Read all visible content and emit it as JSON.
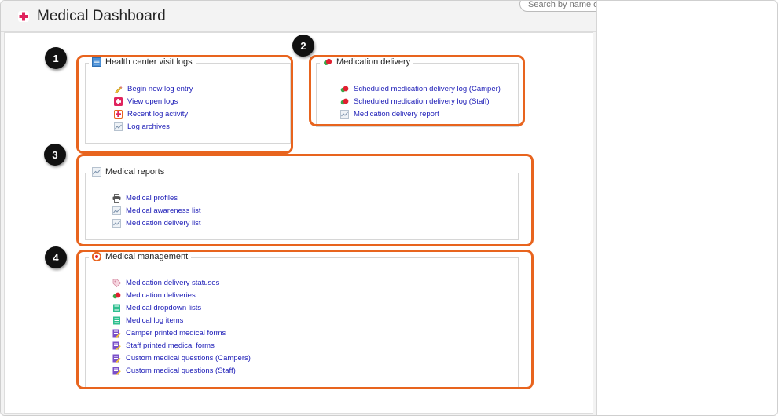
{
  "header": {
    "title": "Medical Dashboard",
    "search_placeholder": "Search by name or e"
  },
  "sections": {
    "visit_logs": {
      "title": "Health center visit logs",
      "items": [
        {
          "label": "Begin new log entry",
          "icon": "pencil-icon"
        },
        {
          "label": "View open logs",
          "icon": "medical-cross-icon"
        },
        {
          "label": "Recent log activity",
          "icon": "medical-cross-outline-icon"
        },
        {
          "label": "Log archives",
          "icon": "chart-icon"
        }
      ]
    },
    "med_delivery": {
      "title": "Medication delivery",
      "items": [
        {
          "label": "Scheduled medication delivery log (Camper)",
          "icon": "pills-icon"
        },
        {
          "label": "Scheduled medication delivery log (Staff)",
          "icon": "pills-icon"
        },
        {
          "label": "Medication delivery report",
          "icon": "chart-icon"
        }
      ]
    },
    "reports": {
      "title": "Medical reports",
      "items": [
        {
          "label": "Medical profiles",
          "icon": "printer-icon"
        },
        {
          "label": "Medical awareness list",
          "icon": "chart-icon"
        },
        {
          "label": "Medication delivery list",
          "icon": "chart-icon"
        }
      ]
    },
    "management": {
      "title": "Medical management",
      "items": [
        {
          "label": "Medication delivery statuses",
          "icon": "tag-icon"
        },
        {
          "label": "Medication deliveries",
          "icon": "pills-icon"
        },
        {
          "label": "Medical dropdown lists",
          "icon": "list-icon"
        },
        {
          "label": "Medical log items",
          "icon": "list-icon"
        },
        {
          "label": "Camper printed medical forms",
          "icon": "form-edit-icon"
        },
        {
          "label": "Staff printed medical forms",
          "icon": "form-edit-icon"
        },
        {
          "label": "Custom medical questions (Campers)",
          "icon": "form-edit-icon"
        },
        {
          "label": "Custom medical questions (Staff)",
          "icon": "form-edit-icon"
        }
      ]
    }
  },
  "callouts": [
    "1",
    "2",
    "3",
    "4"
  ],
  "colors": {
    "accent": "#e8641e",
    "link": "#2020b8",
    "brand_cross": "#e0245e"
  }
}
